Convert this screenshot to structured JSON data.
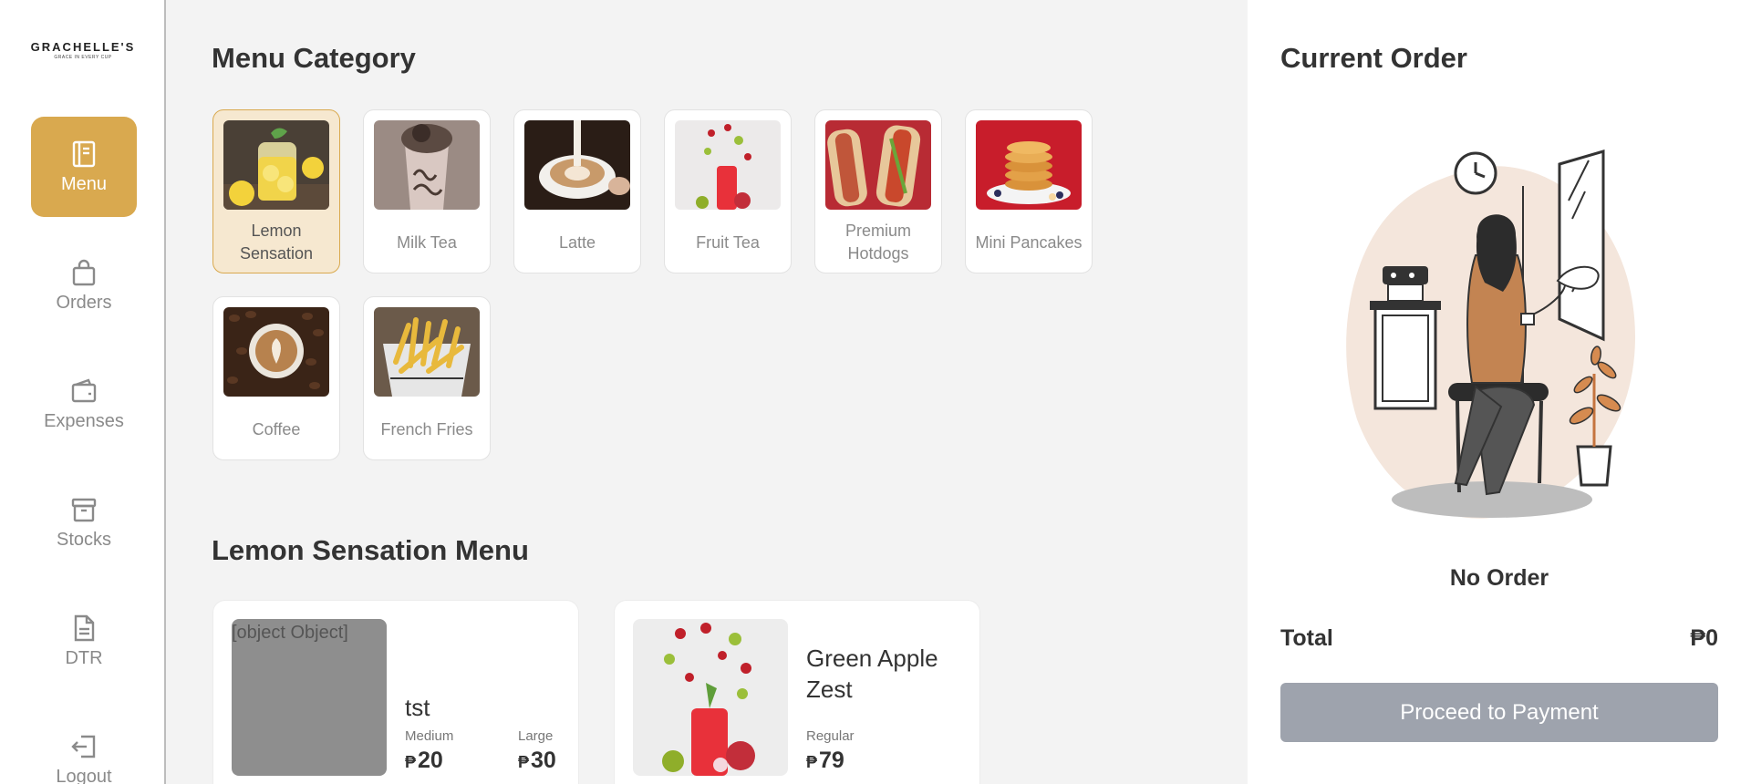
{
  "brand": {
    "name": "GRACHELLE'S",
    "tagline": "GRACE IN EVERY CUP"
  },
  "sidebar": {
    "items": [
      {
        "label": "Menu",
        "icon": "menu-book-icon",
        "active": true
      },
      {
        "label": "Orders",
        "icon": "shopping-bag-icon",
        "active": false
      },
      {
        "label": "Expenses",
        "icon": "wallet-icon",
        "active": false
      },
      {
        "label": "Stocks",
        "icon": "archive-box-icon",
        "active": false
      },
      {
        "label": "DTR",
        "icon": "document-icon",
        "active": false
      },
      {
        "label": "Logout",
        "icon": "logout-icon",
        "active": false
      }
    ]
  },
  "menu_category": {
    "title_bold": "Menu",
    "title_rest": " Category",
    "categories": [
      {
        "name": "Lemon Sensation",
        "image": "lemonade-photo",
        "selected": true
      },
      {
        "name": "Milk Tea",
        "image": "milk-tea-photo",
        "selected": false
      },
      {
        "name": "Latte",
        "image": "latte-photo",
        "selected": false
      },
      {
        "name": "Fruit Tea",
        "image": "fruit-tea-photo",
        "selected": false
      },
      {
        "name": "Premium Hotdogs",
        "image": "hotdogs-photo",
        "selected": false
      },
      {
        "name": "Mini Pancakes",
        "image": "pancakes-photo",
        "selected": false
      },
      {
        "name": "Coffee",
        "image": "coffee-photo",
        "selected": false
      },
      {
        "name": "French Fries",
        "image": "fries-photo",
        "selected": false
      }
    ]
  },
  "category_menu": {
    "title_bold": "Lemon Sensation",
    "title_rest": " Menu",
    "currency": "₱",
    "items": [
      {
        "name": "tst",
        "image_alt": "[object Object]",
        "sizes": [
          {
            "label": "Medium",
            "price": "20"
          },
          {
            "label": "Large",
            "price": "30"
          }
        ]
      },
      {
        "name": "Green Apple Zest",
        "image": "fruit-drink-photo",
        "sizes": [
          {
            "label": "Regular",
            "price": "79"
          }
        ]
      }
    ]
  },
  "current_order": {
    "title_bold": "Current",
    "title_rest": " Order",
    "empty_text": "No Order",
    "total_label": "Total",
    "total_value": "₱0",
    "pay_button": "Proceed to Payment"
  },
  "colors": {
    "accent": "#d9a94f",
    "selected_bg": "#f6e8d0",
    "button_disabled": "#9ea3ad",
    "page_bg": "#f3f3f3"
  }
}
